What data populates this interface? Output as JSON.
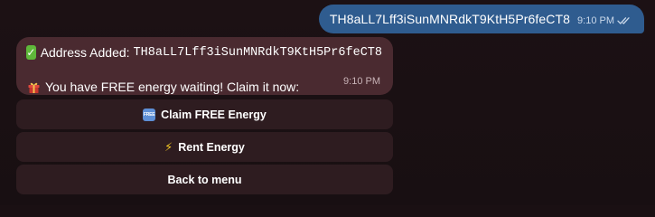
{
  "outgoing_message": {
    "text": "TH8aLL7Lff3iSunMNRdkT9KtH5Pr6feCT8",
    "time": "9:10 PM",
    "status_icon": "double-check-icon"
  },
  "incoming_message": {
    "line1_prefix": "Address Added:",
    "line1_address": "TH8aLL7Lff3iSunMNRdkT9KtH5Pr6feCT8",
    "line1_icon": "check-mark-icon",
    "line2_text": "You have FREE energy waiting! Claim it now:",
    "line2_icon": "gift-icon",
    "time": "9:10 PM"
  },
  "keyboard": {
    "buttons": [
      {
        "label": "Claim FREE Energy",
        "icon": "free-icon"
      },
      {
        "label": "Rent Energy",
        "icon": "lightning-icon"
      },
      {
        "label": "Back to menu",
        "icon": ""
      }
    ]
  },
  "colors": {
    "background": "#1a1013",
    "outgoing_bubble": "#2f5c8f",
    "incoming_bubble": "#4a2a30",
    "keyboard_button": "#2e1c20",
    "check_emoji": "#5fb83a",
    "bolt": "#f3c623"
  }
}
